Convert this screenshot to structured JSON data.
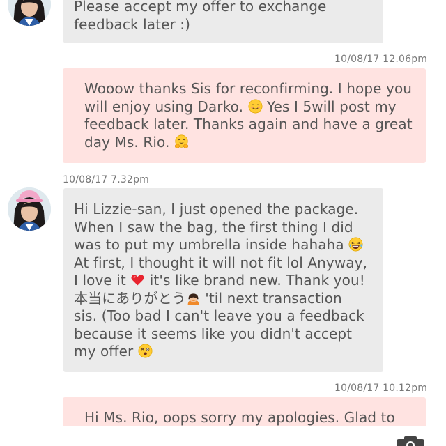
{
  "messages": [
    {
      "lines": [
        "Please accept my offer to exchange",
        "feedback later :)"
      ]
    },
    {
      "timestamp": "10/08/17 12.06pm",
      "lines": [
        "Wooow thanks Sis for reconfirming. I hope you",
        "will enjoy using Darko.",
        " Yes I 5will post my",
        "feedback later. Thanks again and have a great",
        "day Ms. Rio. "
      ],
      "emojis": [
        "smiling-blush-emoji",
        "hugging-face-emoji"
      ]
    },
    {
      "timestamp": "10/08/17 7.32pm",
      "lines": [
        "Hi Lizzie-san, I just opened the package.",
        "When I saw the bag, the first thing I did",
        "was to put my umbrella inside hahaha ",
        "At first, I thought it will not fit lol Anyway,",
        "I love it ",
        " it's like brand new. Thank you!",
        "本当にありがとう",
        " 'til next transaction",
        "sis. (Too bad I can't leave you a feedback",
        "because it seems like you didn't accept",
        "my offer "
      ],
      "emojis": [
        "laughing-tears-emoji",
        "red-heart-emoji",
        "bowing-person-emoji",
        "dizzy-face-emoji"
      ]
    },
    {
      "timestamp": "10/08/17 10.12pm",
      "lines": [
        "Hi Ms. Rio, oops sorry my apologies. Glad to"
      ]
    }
  ],
  "colors": {
    "incoming_bubble": "#ebebeb",
    "outgoing_bubble": "#ffe3e1",
    "message_text": "#555555",
    "timestamp_text": "#777777"
  },
  "icons": {
    "avatar": "avatar",
    "camera": "camera-icon"
  }
}
